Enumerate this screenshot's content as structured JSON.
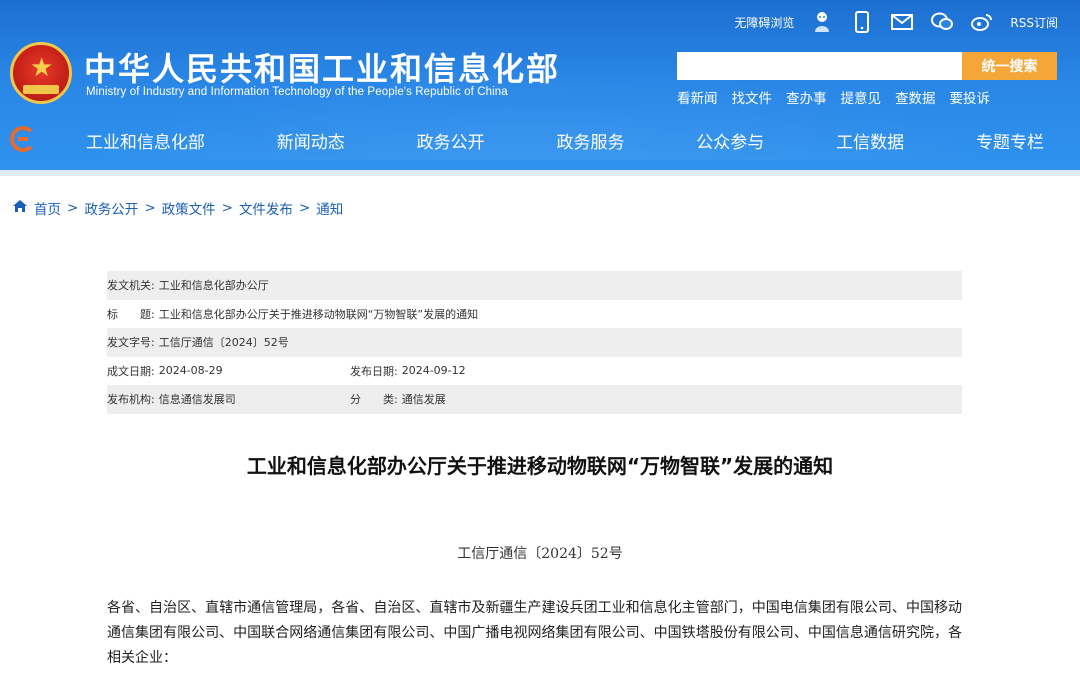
{
  "header": {
    "title": "中华人民共和国工业和信息化部",
    "subtitle": "Ministry of Industry and Information Technology of the People's Republic of China",
    "accessibility": "无障碍浏览",
    "rss": "RSS订阅",
    "top_icons": [
      "accessibility-avatar-icon",
      "mobile-icon",
      "mail-icon",
      "wechat-icon",
      "weibo-icon"
    ],
    "search_placeholder": "",
    "search_button": "统一搜索",
    "quick_links": [
      "看新闻",
      "找文件",
      "查办事",
      "提意见",
      "查数据",
      "要投诉"
    ],
    "colors": {
      "primary": "#2a86e6",
      "accent": "#f4a638"
    }
  },
  "nav": {
    "items": [
      "工业和信息化部",
      "新闻动态",
      "政务公开",
      "政务服务",
      "公众参与",
      "工信数据",
      "专题专栏"
    ]
  },
  "breadcrumb": [
    "首页",
    "政务公开",
    "政策文件",
    "文件发布",
    "通知"
  ],
  "info": {
    "issuer_label": "发文机关:",
    "issuer": "工业和信息化部办公厅",
    "title_label": "标　　题:",
    "title": "工业和信息化部办公厅关于推进移动物联网“万物智联”发展的通知",
    "docno_label": "发文字号:",
    "docno": "工信厅通信〔2024〕52号",
    "created_label": "成文日期:",
    "created": "2024-08-29",
    "published_label": "发布日期:",
    "published": "2024-09-12",
    "org_label": "发布机构:",
    "org": "信息通信发展司",
    "category_label": "分　　类:",
    "category": "通信发展"
  },
  "document": {
    "title": "工业和信息化部办公厅关于推进移动物联网“万物智联”发展的通知",
    "number": "工信厅通信〔2024〕52号",
    "body": "各省、自治区、直辖市通信管理局，各省、自治区、直辖市及新疆生产建设兵团工业和信息化主管部门，中国电信集团有限公司、中国移动通信集团有限公司、中国联合网络通信集团有限公司、中国广播电视网络集团有限公司、中国铁塔股份有限公司、中国信息通信研究院，各相关企业："
  }
}
